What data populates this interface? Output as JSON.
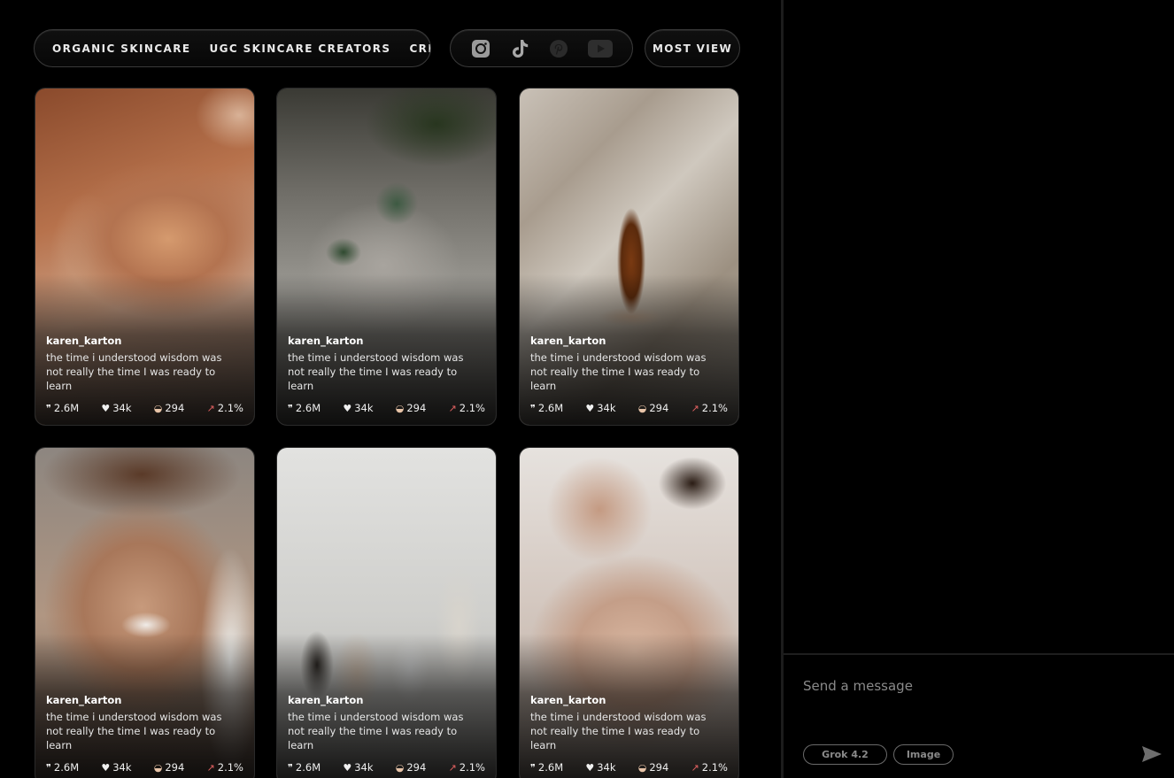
{
  "categories": [
    "ORGANIC SKINCARE",
    "UGC SKINCARE CREATORS",
    "CREAMC"
  ],
  "social_icons": [
    "instagram-icon",
    "tiktok-icon",
    "pinterest-icon",
    "youtube-icon"
  ],
  "sort_label": "MOST VIEW",
  "cards": [
    {
      "user": "karen_karton",
      "caption": "the time i understood wisdom was not really the time I was ready to learn",
      "views": "2.6M",
      "likes": "34k",
      "comments": "294",
      "rate": "2.1%"
    },
    {
      "user": "karen_karton",
      "caption": "the time i understood wisdom was not really the time I was ready to learn",
      "views": "2.6M",
      "likes": "34k",
      "comments": "294",
      "rate": "2.1%"
    },
    {
      "user": "karen_karton",
      "caption": "the time i understood wisdom was not really the time I was ready to learn",
      "views": "2.6M",
      "likes": "34k",
      "comments": "294",
      "rate": "2.1%"
    },
    {
      "user": "karen_karton",
      "caption": "the time i understood wisdom was not really the time I was ready to learn",
      "views": "2.6M",
      "likes": "34k",
      "comments": "294",
      "rate": "2.1%"
    },
    {
      "user": "karen_karton",
      "caption": "the time i understood wisdom was not really the time I was ready to learn",
      "views": "2.6M",
      "likes": "34k",
      "comments": "294",
      "rate": "2.1%"
    },
    {
      "user": "karen_karton",
      "caption": "the time i understood wisdom was not really the time I was ready to learn",
      "views": "2.6M",
      "likes": "34k",
      "comments": "294",
      "rate": "2.1%"
    }
  ],
  "chat": {
    "placeholder": "Send a message",
    "model_chip": "Grok 4.2",
    "image_chip": "Image"
  }
}
